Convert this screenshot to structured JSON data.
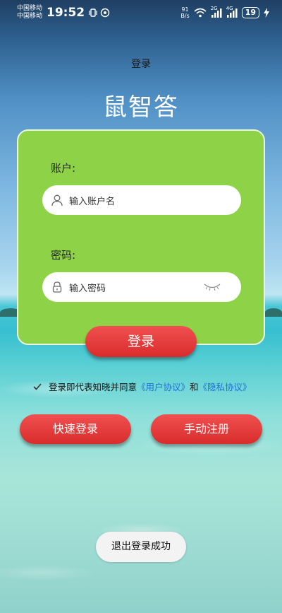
{
  "status_bar": {
    "carrier1": "中国移动",
    "carrier2": "中国移动",
    "time": "19:52",
    "net_speed_value": "91",
    "net_speed_unit": "B/s",
    "signal1_label": "2G",
    "signal2_label": "4G",
    "battery": "19"
  },
  "header": {
    "page_title": "登录",
    "app_title": "鼠智答"
  },
  "login_form": {
    "account_label": "账户:",
    "account_placeholder": "输入账户名",
    "password_label": "密码:",
    "password_placeholder": "输入密码",
    "login_button": "登录"
  },
  "agreement": {
    "checked": true,
    "prefix": "登录即代表知晓并同意",
    "user_agreement": "《用户协议》",
    "conjunction": "和",
    "privacy_policy": "《隐私协议》"
  },
  "actions": {
    "quick_login": "快速登录",
    "manual_register": "手动注册"
  },
  "toast": {
    "message": "退出登录成功"
  },
  "colors": {
    "card_bg": "#8ed347",
    "button_red": "#e63b3b",
    "link_blue": "#1f6fd6"
  }
}
